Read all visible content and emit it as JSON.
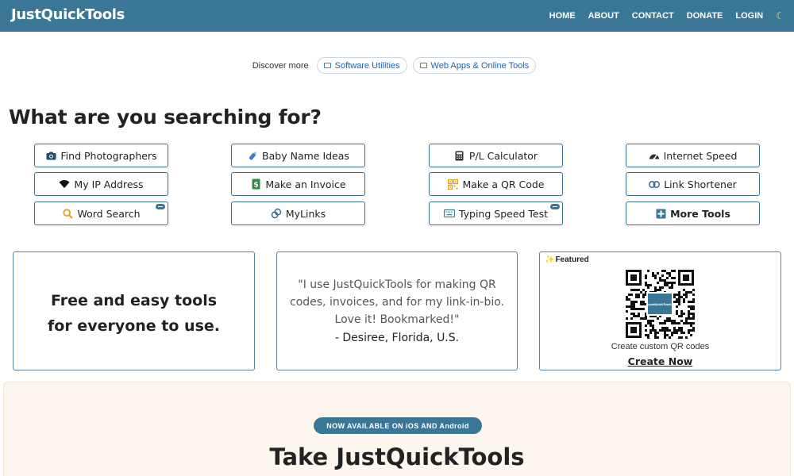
{
  "nav": {
    "logo": "JustQuickTools",
    "links": [
      "HOME",
      "ABOUT",
      "CONTACT",
      "DONATE",
      "LOGIN"
    ],
    "theme_icon": "moon-icon"
  },
  "discover": {
    "label": "Discover more",
    "pills": [
      "Software Utilities",
      "Web Apps & Online Tools"
    ]
  },
  "heading": "What are you searching for?",
  "tools": [
    {
      "label": "Find Photographers",
      "icon": "camera-icon",
      "icon_color": "#1f4e6e"
    },
    {
      "label": "Baby Name Ideas",
      "icon": "baby-bottle-icon",
      "icon_color": "#3b7fd1"
    },
    {
      "label": "P/L Calculator",
      "icon": "calculator-icon",
      "icon_color": "#333333"
    },
    {
      "label": "Internet Speed",
      "icon": "speedometer-icon",
      "icon_color": "#333333"
    },
    {
      "label": "My IP Address",
      "icon": "wifi-icon",
      "icon_color": "#111111"
    },
    {
      "label": "Make an Invoice",
      "icon": "invoice-icon",
      "icon_color": "#2e8b3d"
    },
    {
      "label": "Make a QR Code",
      "icon": "qr-code-icon",
      "icon_color": "#e0a020"
    },
    {
      "label": "Link Shortener",
      "icon": "link-icon",
      "icon_color": "#3a6d8c"
    },
    {
      "label": "Word Search",
      "icon": "magnifier-icon",
      "icon_color": "#e0a020",
      "game": true
    },
    {
      "label": "MyLinks",
      "icon": "link-icon",
      "icon_color": "#3a6d8c"
    },
    {
      "label": "Typing Speed Test",
      "icon": "keyboard-icon",
      "icon_color": "#3a7796",
      "game": true
    },
    {
      "label": "More Tools",
      "icon": "plus-square-icon",
      "icon_color": "#3a7796",
      "bold": true
    }
  ],
  "tagline": [
    "Free and easy tools",
    "for everyone to use."
  ],
  "testimonial": {
    "quote": [
      "\"I use JustQuickTools for making QR",
      "codes, invoices, and for my link-in-bio.",
      "Love it! Bookmarked!\""
    ],
    "author": "- Desiree, Florida, U.S."
  },
  "featured": {
    "label": "Featured",
    "qr_center_text": "JustQuickTools",
    "caption": "Create custom QR codes",
    "cta": "Create Now"
  },
  "promo": {
    "badge": "NOW AVAILABLE ON iOS AND Android",
    "title": "Take JustQuickTools"
  },
  "colors": {
    "brand": "#3a7796",
    "promo_bg": "#fdf6ee"
  }
}
